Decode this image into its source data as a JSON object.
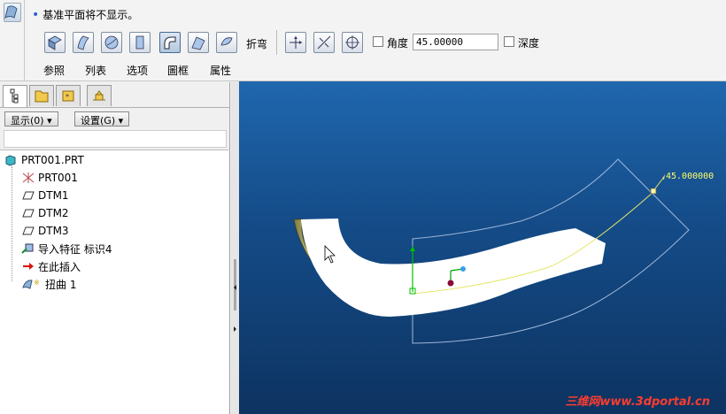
{
  "dashboard": {
    "message": "基准平面将不显示。",
    "fold_label": "折弯",
    "angle_label": "角度",
    "angle_value": "45.00000",
    "depth_label": "深度",
    "tabs": [
      "参照",
      "列表",
      "选项",
      "圖框",
      "属性"
    ]
  },
  "panel": {
    "show_button": "显示(0) ▾",
    "settings_button": "设置(G) ▾"
  },
  "tree": {
    "items": [
      {
        "label": "PRT001.PRT"
      },
      {
        "label": "PRT001"
      },
      {
        "label": "DTM1"
      },
      {
        "label": "DTM2"
      },
      {
        "label": "DTM3"
      },
      {
        "label": "导入特征 标识4"
      },
      {
        "label": "在此插入"
      },
      {
        "label": "扭曲 1"
      }
    ]
  },
  "viewport": {
    "dimension_label": "45.000000",
    "watermark": "三维网www.3dportal.cn"
  },
  "colors": {
    "viewport_top": "#1f67ae",
    "viewport_bottom": "#0d3361",
    "outline": "#9fb7d9",
    "green_axis": "#00c000",
    "yellow_curve": "#e6e66a",
    "watermark": "#ff3b2f"
  }
}
